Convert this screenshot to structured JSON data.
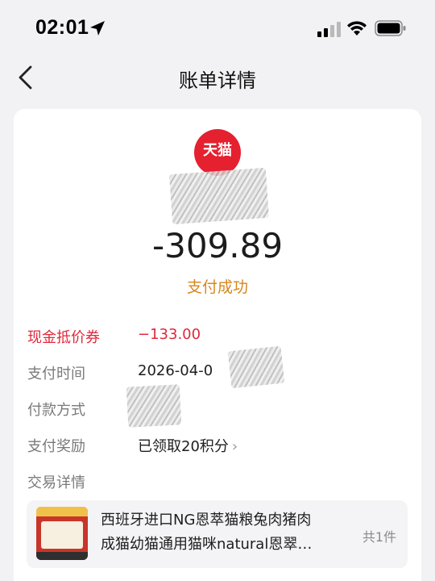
{
  "status_bar": {
    "time": "02:01"
  },
  "nav": {
    "title": "账单详情"
  },
  "merchant": {
    "logo_text": "天猫"
  },
  "amount": "-309.89",
  "status": "支付成功",
  "rows": [
    {
      "label": "现金抵价券",
      "value": "−133.00"
    },
    {
      "label": "支付时间",
      "value": "2026-04-0"
    },
    {
      "label": "付款方式",
      "value": ""
    },
    {
      "label": "支付奖励",
      "value": "已领取20积分"
    },
    {
      "label": "交易详情",
      "value": ""
    }
  ],
  "product": {
    "title_line1": "西班牙进口NG恩萃猫粮兔肉猪肉",
    "title_line2": "成猫幼猫通用猫咪natural恩翠…",
    "count": "共1件"
  },
  "colors": {
    "accent_red": "#e0283b",
    "status_orange": "#d7861b",
    "tmall_red": "#e5202f"
  }
}
